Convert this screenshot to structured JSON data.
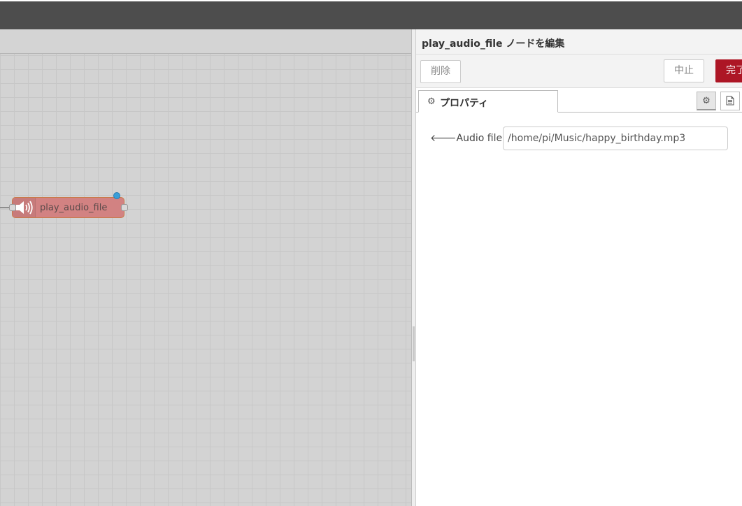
{
  "workspace": {
    "node": {
      "label": "play_audio_file",
      "icon": "speaker-icon",
      "color": "#d28282"
    }
  },
  "tray": {
    "title": "play_audio_file ノードを編集",
    "buttons": {
      "delete_label": "削除",
      "cancel_label": "中止",
      "done_label": "完了"
    },
    "tabs": [
      {
        "label": "プロパティ",
        "icon": "gear-icon",
        "active": true
      }
    ],
    "side_buttons": [
      {
        "icon": "gear-icon"
      },
      {
        "icon": "document-icon"
      }
    ],
    "fields": [
      {
        "label": "Audio file",
        "icon": "arrow-left-icon",
        "value": "/home/pi/Music/happy_birthday.mp3"
      }
    ],
    "accent_color": "#ad1625"
  }
}
